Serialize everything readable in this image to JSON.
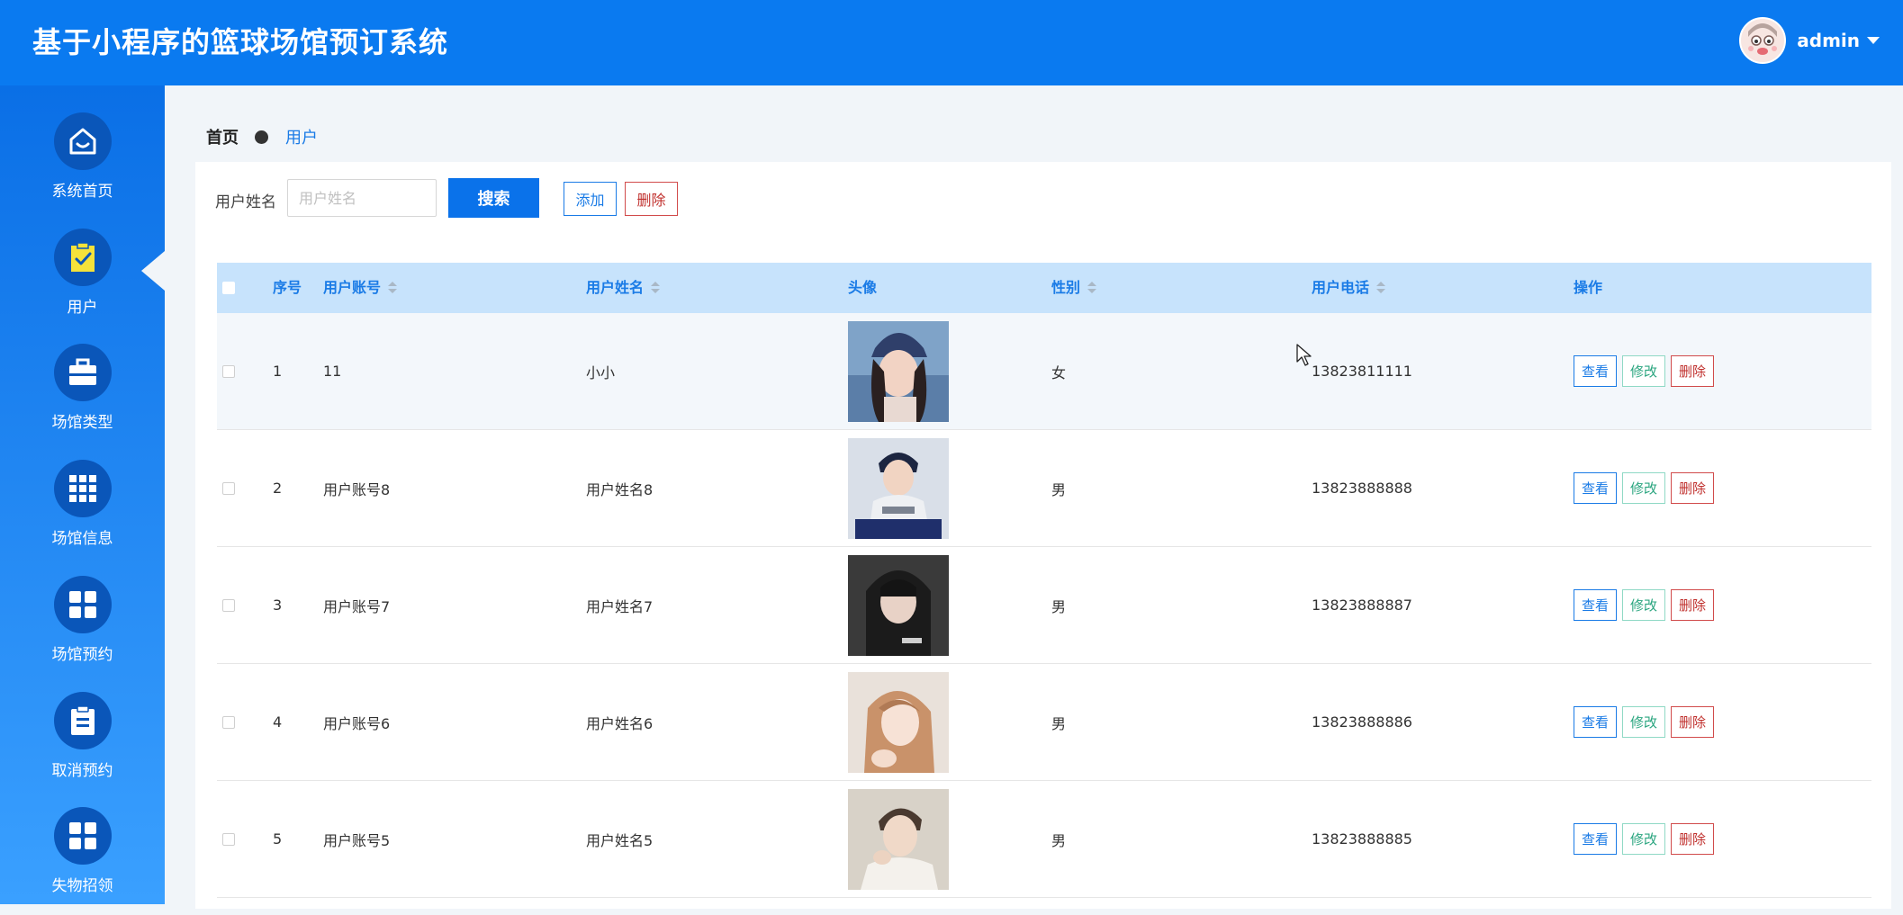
{
  "header": {
    "title": "基于小程序的篮球场馆预订系统",
    "username": "admin"
  },
  "sidebar": {
    "items": [
      {
        "label": "系统首页",
        "icon": "home-icon"
      },
      {
        "label": "用户",
        "icon": "clipboard-check-icon",
        "active": true
      },
      {
        "label": "场馆类型",
        "icon": "briefcase-icon"
      },
      {
        "label": "场馆信息",
        "icon": "grid-nine-icon"
      },
      {
        "label": "场馆预约",
        "icon": "grid-four-icon"
      },
      {
        "label": "取消预约",
        "icon": "clipboard-list-icon"
      },
      {
        "label": "失物招领",
        "icon": "grid-four-icon"
      }
    ]
  },
  "breadcrumb": {
    "home": "首页",
    "current": "用户"
  },
  "search": {
    "label": "用户姓名",
    "placeholder": "用户姓名",
    "value": "",
    "button": "搜索"
  },
  "toolbar": {
    "add": "添加",
    "delete": "删除"
  },
  "table": {
    "headers": {
      "index": "序号",
      "account": "用户账号",
      "name": "用户姓名",
      "avatar": "头像",
      "gender": "性别",
      "phone": "用户电话",
      "actions": "操作"
    },
    "actions": {
      "view": "查看",
      "edit": "修改",
      "delete": "删除"
    },
    "rows": [
      {
        "index": "1",
        "account": "11",
        "name": "小小",
        "gender": "女",
        "phone": "13823811111"
      },
      {
        "index": "2",
        "account": "用户账号8",
        "name": "用户姓名8",
        "gender": "男",
        "phone": "13823888888"
      },
      {
        "index": "3",
        "account": "用户账号7",
        "name": "用户姓名7",
        "gender": "男",
        "phone": "13823888887"
      },
      {
        "index": "4",
        "account": "用户账号6",
        "name": "用户姓名6",
        "gender": "男",
        "phone": "13823888886"
      },
      {
        "index": "5",
        "account": "用户账号5",
        "name": "用户姓名5",
        "gender": "男",
        "phone": "13823888885"
      }
    ]
  },
  "colors": {
    "primary": "#0a7af0",
    "accent": "#1a7be6",
    "danger": "#c0302d",
    "success": "#2aa57f",
    "table_header": "#c7e3fc"
  }
}
